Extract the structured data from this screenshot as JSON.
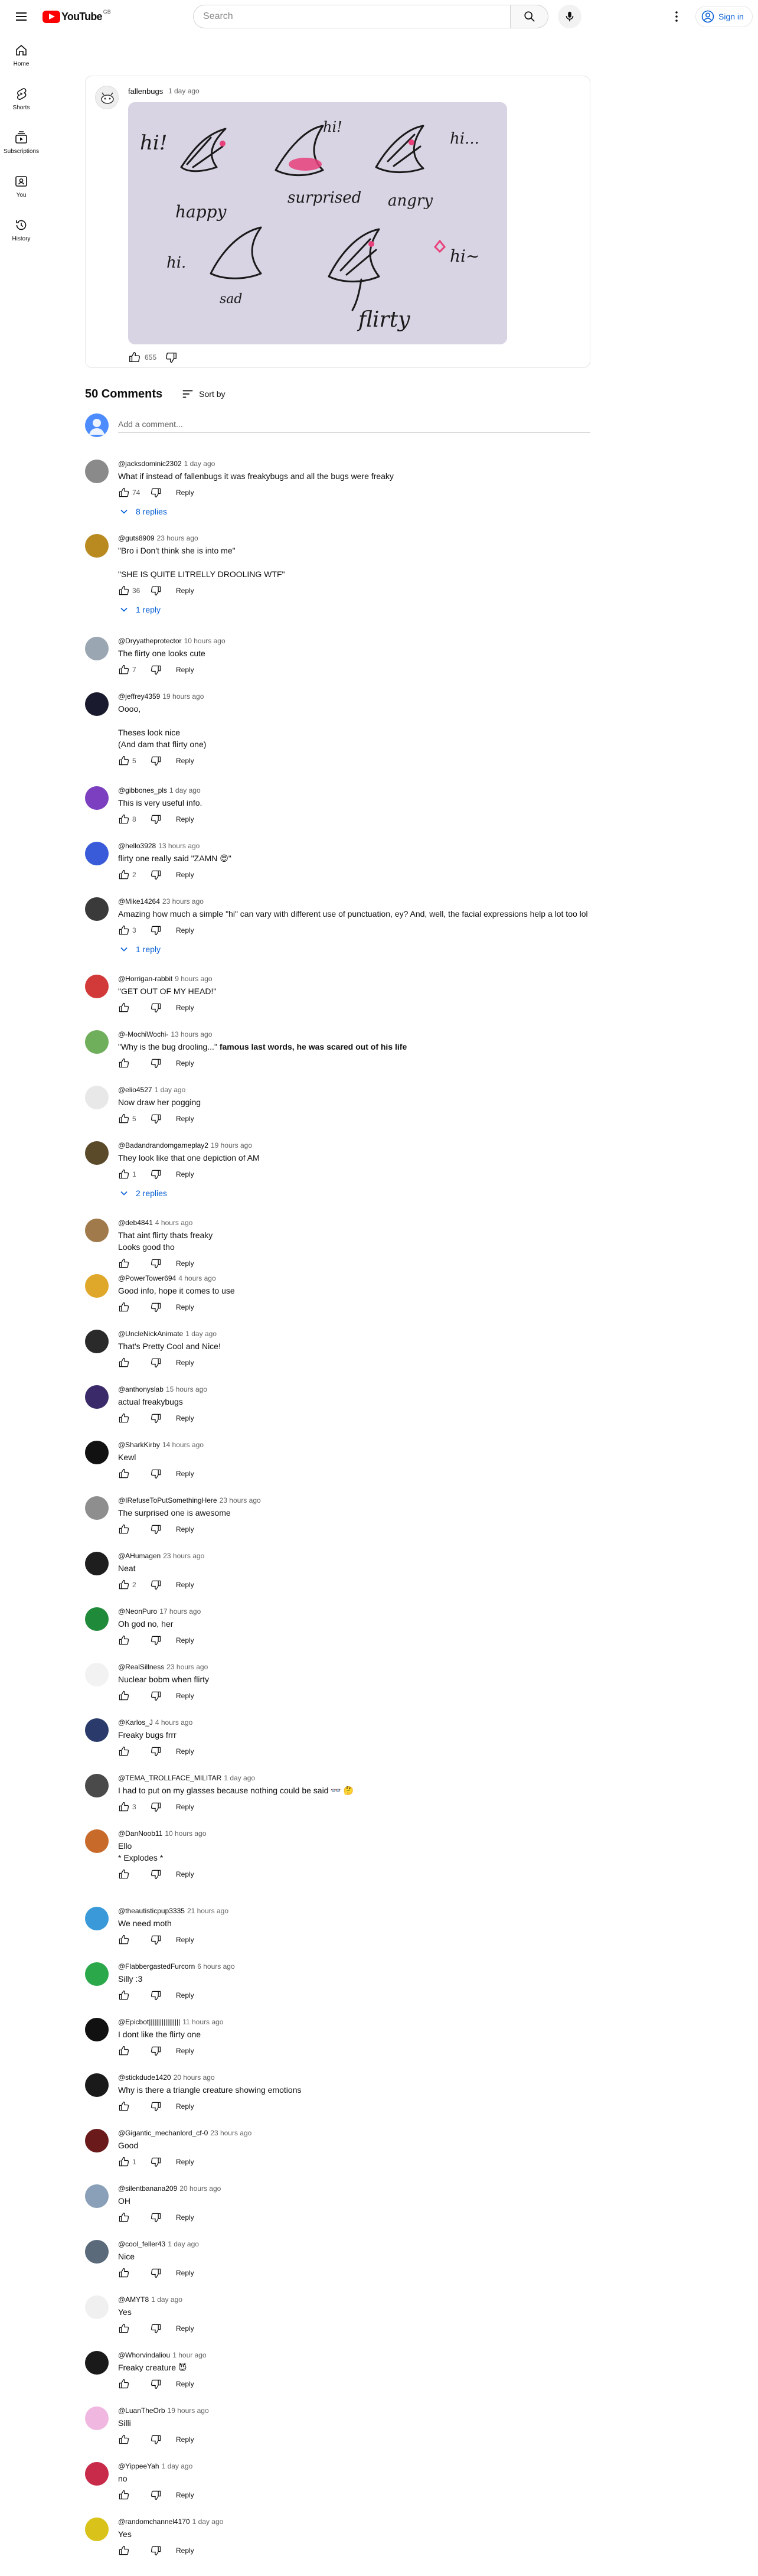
{
  "header": {
    "logo_text": "YouTube",
    "country_code": "GB",
    "search_placeholder": "Search",
    "sign_in_label": "Sign in"
  },
  "guide": {
    "items": [
      {
        "label": "Home",
        "icon": "home-icon"
      },
      {
        "label": "Shorts",
        "icon": "shorts-icon"
      },
      {
        "label": "Subscriptions",
        "icon": "subscriptions-icon"
      },
      {
        "label": "You",
        "icon": "you-icon"
      },
      {
        "label": "History",
        "icon": "history-icon"
      }
    ]
  },
  "post": {
    "author": "fallenbugs",
    "time": "1 day ago",
    "likes": "655",
    "image": {
      "background": "#d8d4e4",
      "captions": [
        "hi!",
        "hi!",
        "hi...",
        "happy",
        "surprised",
        "angry",
        "hi.",
        "sad",
        "hi~",
        "flirty"
      ]
    }
  },
  "comments_section": {
    "count_label": "50 Comments",
    "sort_label": "Sort by",
    "add_comment_placeholder": "Add a comment..."
  },
  "comments": [
    {
      "author": "@jacksdominic2302",
      "time": "1 day ago",
      "text": "What if instead of fallenbugs it was freakybugs and all the bugs were freaky",
      "likes": "74",
      "replies": "8 replies",
      "avatar_color": "#8a8a8a"
    },
    {
      "author": "@guts8909",
      "time": "23 hours ago",
      "text": "\"Bro i Don't think she is into me\"\n\n\"SHE IS QUITE LITRELLY DROOLING WTF\"",
      "likes": "36",
      "replies": "1 reply",
      "avatar_color": "#b88a20"
    },
    {
      "author": "@Dryyatheprotector",
      "time": "10 hours ago",
      "text": "The flirty one looks cute",
      "likes": "7",
      "replies": "",
      "avatar_color": "#9aa6b2"
    },
    {
      "author": "@jeffrey4359",
      "time": "19 hours ago",
      "text": "Oooo,\n\nTheses look nice\n(And dam that flirty one)",
      "likes": "5",
      "replies": "",
      "avatar_color": "#1a1a2e"
    },
    {
      "author": "@gibbones_pls",
      "time": "1 day ago",
      "text": "This is very useful info.",
      "likes": "8",
      "replies": "",
      "avatar_color": "#7b3fbf"
    },
    {
      "author": "@hello3928",
      "time": "13 hours ago",
      "text": "flirty one really said \"ZAMN 😍\"",
      "likes": "2",
      "replies": "",
      "avatar_color": "#3a5bd9"
    },
    {
      "author": "@Mike14264",
      "time": "23 hours ago",
      "text": "Amazing how much a simple \"hi\" can vary with different use of punctuation, ey? And, well, the facial expressions help a lot too lol",
      "likes": "3",
      "replies": "1 reply",
      "avatar_color": "#3a3a3a"
    },
    {
      "author": "@Horrigan-rabbit",
      "time": "9 hours ago",
      "text": "\"GET OUT OF MY HEAD!\"",
      "likes": "",
      "replies": "",
      "avatar_color": "#d23a3a"
    },
    {
      "author": "@-MochiWochi-",
      "time": "13 hours ago",
      "text": "\"Why is the bug drooling...\" ",
      "text_bold": "famous last words, he was scared out of his life",
      "likes": "",
      "replies": "",
      "avatar_color": "#6fae5a"
    },
    {
      "author": "@elio4527",
      "time": "1 day ago",
      "text": "Now draw her pogging",
      "likes": "5",
      "replies": "",
      "avatar_color": "#e8e8e8"
    },
    {
      "author": "@Badandrandomgameplay2",
      "time": "19 hours ago",
      "text": "They look like that one depiction of AM",
      "likes": "1",
      "replies": "2 replies",
      "avatar_color": "#5a4a2a"
    },
    {
      "author": "@deb4841",
      "time": "4 hours ago",
      "text": "That aint flirty thats freaky\nLooks good tho",
      "likes": "",
      "replies": "",
      "avatar_color": "#a07a4a"
    },
    {
      "author": "@PowerTower694",
      "time": "4 hours ago",
      "text": "Good info, hope it comes to use",
      "likes": "",
      "replies": "",
      "avatar_color": "#e0a82a"
    },
    {
      "author": "@UncleNickAnimate",
      "time": "1 day ago",
      "text": "That's Pretty Cool and Nice!",
      "likes": "",
      "replies": "",
      "avatar_color": "#2a2a2a"
    },
    {
      "author": "@anthonyslab",
      "time": "15 hours ago",
      "text": "actual freakybugs",
      "likes": "",
      "replies": "",
      "avatar_color": "#3a2a6a"
    },
    {
      "author": "@SharkKirby",
      "time": "14 hours ago",
      "text": "Kewl",
      "likes": "",
      "replies": "",
      "avatar_color": "#111111"
    },
    {
      "author": "@IRefuseToPutSomethingHere",
      "time": "23 hours ago",
      "text": "The surprised one is awesome",
      "likes": "",
      "replies": "",
      "avatar_color": "#8e8e8e"
    },
    {
      "author": "@AHumagen",
      "time": "23 hours ago",
      "text": "Neat",
      "likes": "2",
      "replies": "",
      "avatar_color": "#1e1e1e"
    },
    {
      "author": "@NeonPuro",
      "time": "17 hours ago",
      "text": "Oh god no, her",
      "likes": "",
      "replies": "",
      "avatar_color": "#1f8a3a"
    },
    {
      "author": "@RealSillness",
      "time": "23 hours ago",
      "text": "Nuclear bobm when flirty",
      "likes": "",
      "replies": "",
      "avatar_color": "#f2f2f2"
    },
    {
      "author": "@Karlos_J",
      "time": "4 hours ago",
      "text": "Freaky bugs frrr",
      "likes": "",
      "replies": "",
      "avatar_color": "#2a3a6a"
    },
    {
      "author": "@TEMA_TROLLFACE_MILITAR",
      "time": "1 day ago",
      "text": "I had to put on my glasses because nothing could be said 👓 🤔",
      "likes": "3",
      "replies": "",
      "avatar_color": "#4a4a4a"
    },
    {
      "author": "@DanNoob11",
      "time": "10 hours ago",
      "text": "Ello\n* Explodes *",
      "likes": "",
      "replies": "",
      "avatar_color": "#c86a2a"
    },
    {
      "author": "@theautisticpup3335",
      "time": "21 hours ago",
      "text": "We need moth",
      "likes": "",
      "replies": "",
      "avatar_color": "#3a9ad9"
    },
    {
      "author": "@FlabbergastedFurcorn",
      "time": "6 hours ago",
      "text": "Silly :3",
      "likes": "",
      "replies": "",
      "avatar_color": "#2aa84a"
    },
    {
      "author": "@Epicbot|||||||||||||||||",
      "time": "11 hours ago",
      "text": "I dont like the flirty one",
      "likes": "",
      "replies": "",
      "avatar_color": "#111111"
    },
    {
      "author": "@stickdude1420",
      "time": "20 hours ago",
      "text": "Why is there a triangle creature showing emotions",
      "likes": "",
      "replies": "",
      "avatar_color": "#1a1a1a"
    },
    {
      "author": "@Gigantic_mechanlord_cf-0",
      "time": "23 hours ago",
      "text": "Good",
      "likes": "1",
      "replies": "",
      "avatar_color": "#6a1a1a"
    },
    {
      "author": "@silentbanana209",
      "time": "20 hours ago",
      "text": "OH",
      "likes": "",
      "replies": "",
      "avatar_color": "#8aa0b8"
    },
    {
      "author": "@cool_feller43",
      "time": "1 day ago",
      "text": "Nice",
      "likes": "",
      "replies": "",
      "avatar_color": "#5a6a7a"
    },
    {
      "author": "@AMYT8",
      "time": "1 day ago",
      "text": "Yes",
      "likes": "",
      "replies": "",
      "avatar_color": "#f0f0f0"
    },
    {
      "author": "@Whorvindaliou",
      "time": "1 hour ago",
      "text": "Freaky creature 😈",
      "likes": "",
      "replies": "",
      "avatar_color": "#1a1a1a"
    },
    {
      "author": "@LuanTheOrb",
      "time": "19 hours ago",
      "text": "Silli",
      "likes": "",
      "replies": "",
      "avatar_color": "#f0b8e0"
    },
    {
      "author": "@YippeeYah",
      "time": "1 day ago",
      "text": "no",
      "likes": "",
      "replies": "",
      "avatar_color": "#c82a4a"
    },
    {
      "author": "@randomchannel4170",
      "time": "1 day ago",
      "text": "Yes",
      "likes": "",
      "replies": "",
      "avatar_color": "#d9c21a"
    }
  ]
}
